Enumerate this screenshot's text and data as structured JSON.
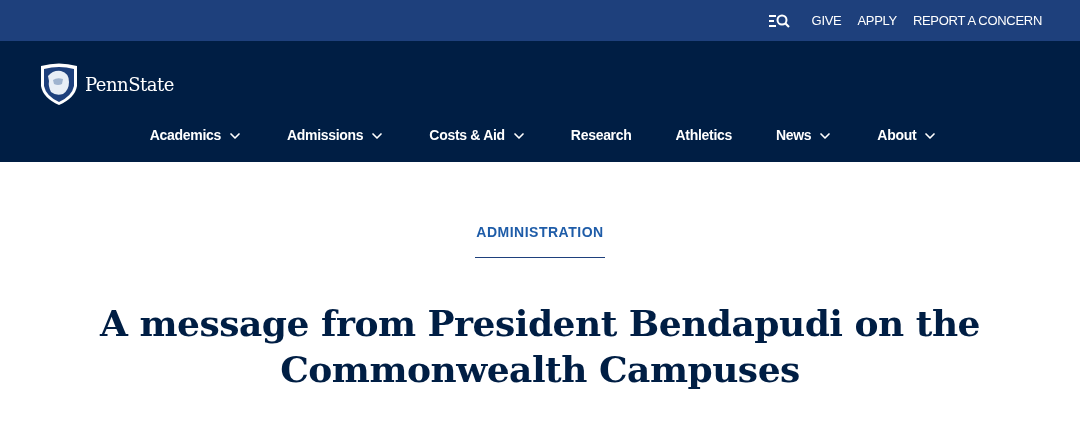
{
  "utility_links": [
    "GIVE",
    "APPLY",
    "REPORT A CONCERN"
  ],
  "logo": {
    "text": "PennState"
  },
  "nav": [
    {
      "label": "Academics",
      "dropdown": true
    },
    {
      "label": "Admissions",
      "dropdown": true
    },
    {
      "label": "Costs & Aid",
      "dropdown": true
    },
    {
      "label": "Research",
      "dropdown": false
    },
    {
      "label": "Athletics",
      "dropdown": false
    },
    {
      "label": "News",
      "dropdown": true
    },
    {
      "label": "About",
      "dropdown": true
    }
  ],
  "article": {
    "category": "ADMINISTRATION",
    "title": "A message from President Bendapudi on the Commonwealth Campuses"
  }
}
